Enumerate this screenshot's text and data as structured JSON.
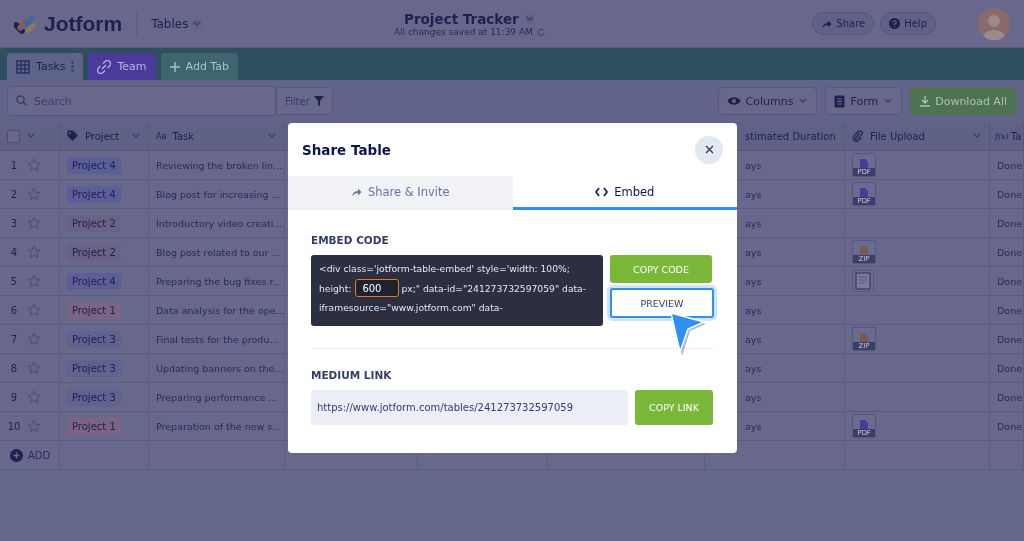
{
  "header": {
    "logo": "Jotform",
    "workspace": "Tables",
    "title": "Project Tracker",
    "save_status": "All changes saved at 11:39 AM",
    "share": "Share",
    "help": "Help"
  },
  "tabs": [
    {
      "label": "Tasks",
      "selected": true,
      "color": "#5e6489"
    },
    {
      "label": "Team",
      "selected": false,
      "color": "#4a3a9a"
    }
  ],
  "add_tab": "Add Tab",
  "toolbar": {
    "search_placeholder": "Search",
    "filter": "Filter",
    "columns": "Columns",
    "form": "Form",
    "download": "Download All"
  },
  "table": {
    "columns": [
      {
        "label": "Project"
      },
      {
        "label": "Task",
        "type_label": "Aa"
      },
      {
        "label": "stimated Duration"
      },
      {
        "label": "File Upload"
      },
      {
        "label": "Ta",
        "type_label": "f(x)"
      }
    ],
    "header_checked": false,
    "rows": [
      {
        "number": "1",
        "starred": false,
        "project": "Project 4",
        "color": "#5c5e98",
        "task": "Reviewing the broken lin...",
        "duration": "ays",
        "file": {
          "kind": "doc",
          "label": "PDF"
        },
        "status": "Done"
      },
      {
        "number": "2",
        "starred": false,
        "project": "Project 4",
        "color": "#5c5e98",
        "task": "Blog post for increasing ...",
        "duration": "ays",
        "file": {
          "kind": "doc",
          "label": "PDF"
        },
        "status": "Done"
      },
      {
        "number": "3",
        "starred": false,
        "project": "Project 2",
        "color": "#6a6282",
        "task": "Introductory video creati...",
        "duration": "ays",
        "status": "Done"
      },
      {
        "number": "4",
        "starred": false,
        "project": "Project 2",
        "color": "#6a6282",
        "task": "Blog post related to our ...",
        "duration": "ays",
        "file": {
          "kind": "archive",
          "label": "ZIP"
        },
        "status": "Done"
      },
      {
        "number": "5",
        "starred": false,
        "project": "Project 4",
        "color": "#5c5e98",
        "task": "Preparing the bug fixes r...",
        "duration": "ays",
        "file": {
          "kind": "image"
        },
        "status": "Done"
      },
      {
        "number": "6",
        "starred": false,
        "project": "Project 1",
        "color": "#7c6482",
        "task": "Data analysis for the ope...",
        "duration": "ays",
        "status": "Done"
      },
      {
        "number": "7",
        "starred": false,
        "project": "Project 3",
        "color": "#60628f",
        "task": "Final tests for the produ...",
        "duration": "ays",
        "file": {
          "kind": "archive",
          "label": "ZIP"
        },
        "status": "Done"
      },
      {
        "number": "8",
        "starred": false,
        "project": "Project 3",
        "color": "#60628f",
        "task": "Updating banners on the...",
        "duration": "ays",
        "status": "Done"
      },
      {
        "number": "9",
        "starred": false,
        "project": "Project 3",
        "color": "#60628f",
        "task": "Preparing performance ...",
        "duration": "ays",
        "status": "Done"
      },
      {
        "number": "10",
        "starred": false,
        "project": "Project 1",
        "color": "#7c6482",
        "task": "Preparation of the new s...",
        "duration": "ays",
        "file": {
          "kind": "doc",
          "label": "PDF"
        },
        "status": "Done"
      }
    ],
    "add_row": "ADD"
  },
  "modal": {
    "title": "Share Table",
    "tabs": [
      {
        "label": "Share & Invite",
        "selected": false
      },
      {
        "label": "Embed",
        "selected": true
      }
    ],
    "embed_label": "EMBED CODE",
    "code": {
      "line_1": "<div class='jotform-table-embed' style='width: 100%;",
      "line_2_before": "height:",
      "height_value": "600",
      "line_2_after": "px;\" data-id=\"241273732597059\" data-",
      "line_3": "iframesource=\"www.jotform.com\" data-"
    },
    "copy_code": "COPY CODE",
    "preview": "PREVIEW",
    "link_label": "MEDIUM LINK",
    "link": "https://www.jotform.com/tables/241273732597059",
    "copy_link": "COPY LINK"
  }
}
